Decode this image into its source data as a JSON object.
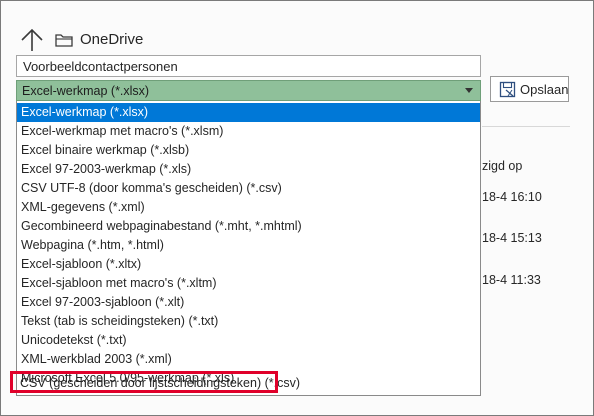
{
  "location": {
    "up_icon": "up-arrow-icon",
    "folder_icon": "folder-icon",
    "name": "OneDrive"
  },
  "filename": {
    "value": "Voorbeeldcontactpersonen"
  },
  "format_select": {
    "selected": "Excel-werkmap (*.xlsx)",
    "accent": "#8fc09a"
  },
  "save_button": {
    "label": "Opslaan",
    "icon": "save-icon"
  },
  "background": {
    "column_header": "zigd op",
    "dates": [
      "18-4 16:10",
      "18-4 15:13",
      "18-4 11:33"
    ]
  },
  "options": [
    "Excel-werkmap (*.xlsx)",
    "Excel-werkmap met macro's (*.xlsm)",
    "Excel binaire werkmap (*.xlsb)",
    "Excel 97-2003-werkmap (*.xls)",
    "CSV UTF-8 (door komma's gescheiden) (*.csv)",
    "XML-gegevens (*.xml)",
    "Gecombineerd webpaginabestand (*.mht, *.mhtml)",
    "Webpagina (*.htm, *.html)",
    "Excel-sjabloon (*.xltx)",
    "Excel-sjabloon met macro's (*.xltm)",
    "Excel 97-2003-sjabloon (*.xlt)",
    "Tekst (tab is scheidingsteken) (*.txt)",
    "Unicodetekst (*.txt)",
    "XML-werkblad 2003 (*.xml)",
    "Microsoft Excel 5.0/95-werkmap (*.xls)",
    "CSV (gescheiden door lijstscheidingsteken) (*.csv)"
  ],
  "selected_option_color": "#0078d7",
  "highlight_color": "#e0002a"
}
